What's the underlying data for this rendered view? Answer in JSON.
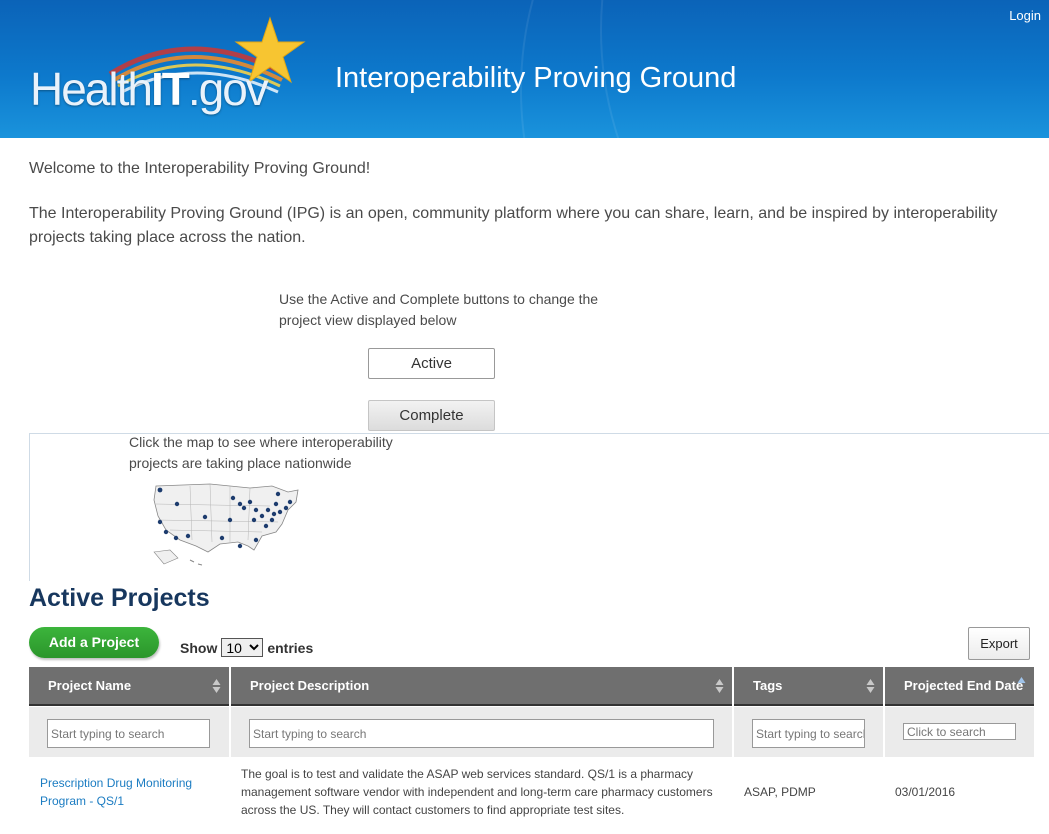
{
  "header": {
    "logo_prefix": "Health",
    "logo_bold": "IT",
    "logo_suffix": ".gov",
    "site_title": "Interoperability Proving Ground",
    "login_label": "Login"
  },
  "intro": {
    "welcome": "Welcome to the Interoperability Proving Ground!",
    "description": "The Interoperability Proving Ground (IPG) is an open, community platform where you can share, learn, and be inspired by interoperability projects taking place across the nation."
  },
  "view_toggle": {
    "instructions": "Use the Active and Complete buttons to change the project view displayed below",
    "active_label": "Active",
    "complete_label": "Complete"
  },
  "map": {
    "caption": "Click the map to see where interoperability projects are taking place nationwide"
  },
  "projects": {
    "title": "Active Projects",
    "add_label": "Add a Project",
    "show_label": "Show",
    "entries_value": "10",
    "entries_label": "entries",
    "export_label": "Export",
    "columns": [
      "Project Name",
      "Project Description",
      "Tags",
      "Projected End Date"
    ],
    "filters": {
      "name_placeholder": "Start typing to search",
      "description_placeholder": "Start typing to search",
      "tags_placeholder": "Start typing to search",
      "date_placeholder": "Click to search"
    },
    "rows": [
      {
        "name": "Prescription Drug Monitoring Program - QS/1",
        "description": "The goal is to test and validate the ASAP web services standard. QS/1 is a pharmacy management software vendor with independent and long-term care pharmacy customers across the US. They will contact customers to find appropriate test sites.",
        "tags": "ASAP, PDMP",
        "end_date": "03/01/2016"
      }
    ]
  },
  "colors": {
    "header_blue": "#0d79cc",
    "title_navy": "#17375e",
    "add_green": "#2e9e2e",
    "link_blue": "#1b7cc2",
    "table_header": "#6f6f6f"
  }
}
